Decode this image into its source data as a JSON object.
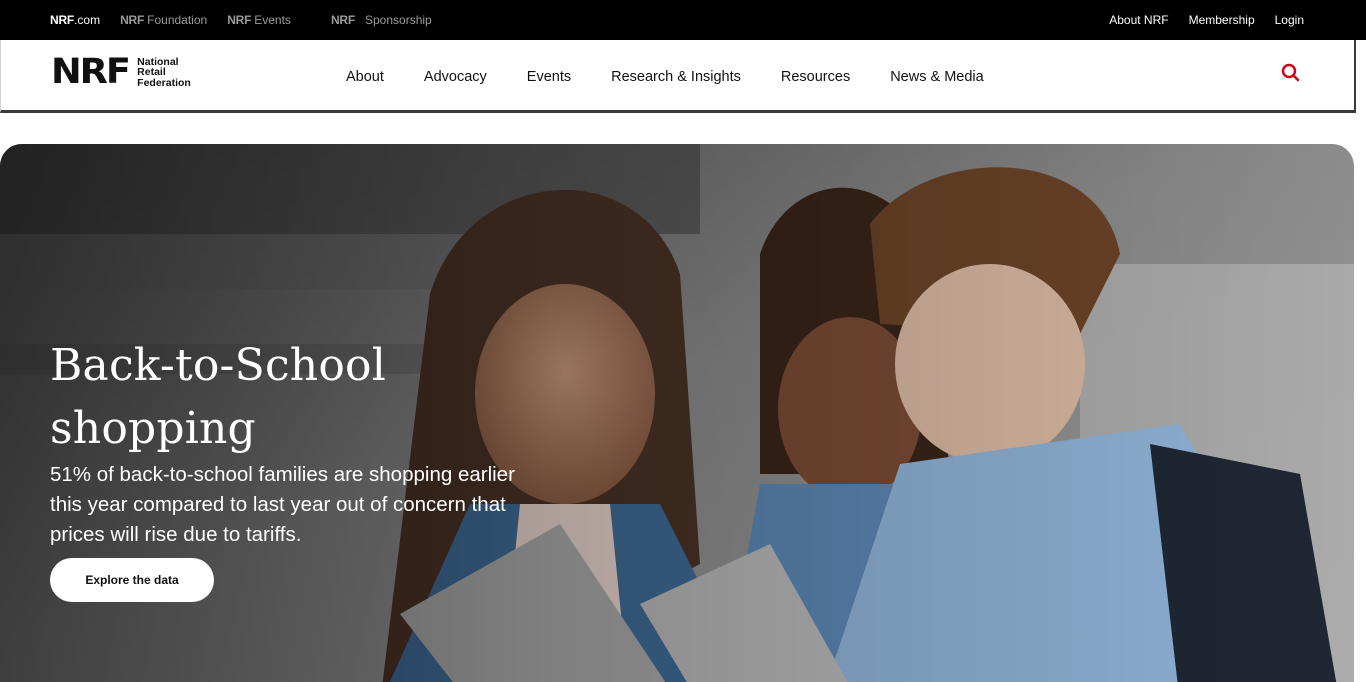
{
  "topbar": {
    "brand_links": [
      {
        "prefix": "NRF",
        "suffix": ".com"
      },
      {
        "prefix": "NRF",
        "suffix": "Foundation"
      },
      {
        "prefix": "NRF",
        "suffix": "Events"
      },
      {
        "prefix": "NRF",
        "suffix": "Sponsorship"
      }
    ],
    "utility_links": [
      "About NRF",
      "Membership",
      "Login"
    ]
  },
  "header": {
    "logo": {
      "mark": "NRF",
      "lines": [
        "National",
        "Retail",
        "Federation"
      ],
      "registered": "®"
    },
    "nav": [
      "About",
      "Advocacy",
      "Events",
      "Research & Insights",
      "Resources",
      "News & Media"
    ],
    "search_icon": "search-icon"
  },
  "hero": {
    "title_line1": "Back-to-School",
    "title_line2": "shopping",
    "description": "51% of back-to-school families are shopping earlier this year compared to last year out of concern that prices will rise due to tariffs.",
    "cta_label": "Explore the data"
  },
  "colors": {
    "topbar_bg": "#000000",
    "accent_red": "#d0021b",
    "text_dark": "#111111"
  }
}
